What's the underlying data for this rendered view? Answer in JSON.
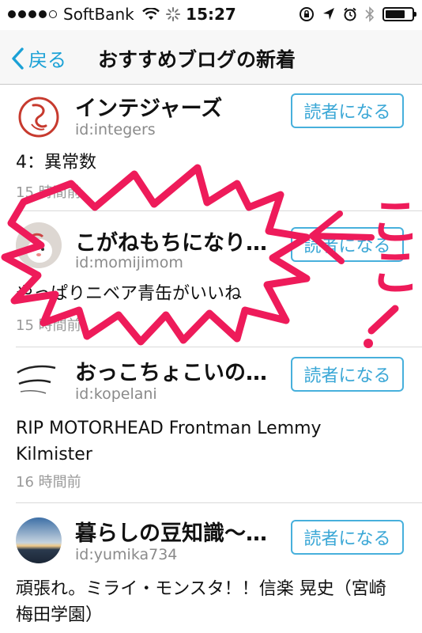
{
  "status_bar": {
    "carrier": "SoftBank",
    "time": "15:27"
  },
  "nav": {
    "back_label": "戻る",
    "title": "おすすめブログの新着"
  },
  "read_button_label": "読者になる",
  "entries": [
    {
      "name": "インテジャーズ",
      "id": "id:integers",
      "title": "4：異常数",
      "time": "15 時間前"
    },
    {
      "name": "こがねもちになり…",
      "id": "id:momijimom",
      "title": "やっぱりニベア青缶がいいね",
      "time": "15 時間前"
    },
    {
      "name": "おっこちょこいの…",
      "id": "id:kopelani",
      "title": "RIP MOTORHEAD Frontman Lemmy Kilmister",
      "time": "16 時間前"
    },
    {
      "name": "暮らしの豆知識～…",
      "id": "id:yumika734",
      "title": "頑張れ。ミライ・モンスタ！！信楽 晃史（宮崎梅田学園）",
      "time": ""
    }
  ],
  "annotation": {
    "text": "ここ",
    "color": "#ee1b5a"
  },
  "colors": {
    "accent": "#1ba1d6",
    "annotation": "#ee1b5a"
  }
}
